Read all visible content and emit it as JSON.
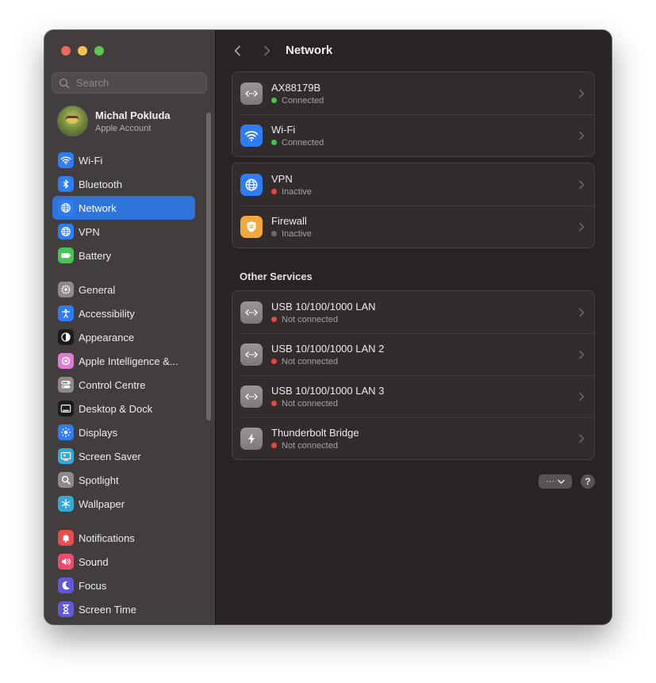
{
  "window": {
    "title": "Network"
  },
  "search": {
    "placeholder": "Search"
  },
  "account": {
    "name": "Michal Pokluda",
    "subtitle": "Apple Account"
  },
  "sidebar": {
    "groups": [
      [
        {
          "label": "Wi-Fi",
          "icon": "wifi-icon",
          "color": "#2f7df6"
        },
        {
          "label": "Bluetooth",
          "icon": "bluetooth-icon",
          "color": "#2f7df6"
        },
        {
          "label": "Network",
          "icon": "globe-icon",
          "color": "#2f7df6",
          "active": true
        },
        {
          "label": "VPN",
          "icon": "globe-icon",
          "color": "#2f7df6"
        },
        {
          "label": "Battery",
          "icon": "battery-icon",
          "color": "#45c553"
        }
      ],
      [
        {
          "label": "General",
          "icon": "gear-icon",
          "color": "#8e8a8a"
        },
        {
          "label": "Accessibility",
          "icon": "accessibility-icon",
          "color": "#2f7df6"
        },
        {
          "label": "Appearance",
          "icon": "appearance-icon",
          "color": "#1c1c1c"
        },
        {
          "label": "Apple Intelligence &...",
          "icon": "apple-intelligence-icon",
          "color": "#e07bd0"
        },
        {
          "label": "Control Centre",
          "icon": "control-centre-icon",
          "color": "#8e8a8a"
        },
        {
          "label": "Desktop & Dock",
          "icon": "dock-icon",
          "color": "#1c1c1c"
        },
        {
          "label": "Displays",
          "icon": "displays-icon",
          "color": "#2f7df6"
        },
        {
          "label": "Screen Saver",
          "icon": "screen-saver-icon",
          "color": "#35a9d6"
        },
        {
          "label": "Spotlight",
          "icon": "spotlight-icon",
          "color": "#8e8a8a"
        },
        {
          "label": "Wallpaper",
          "icon": "wallpaper-icon",
          "color": "#35a9d6"
        }
      ],
      [
        {
          "label": "Notifications",
          "icon": "notifications-icon",
          "color": "#ea4b4b"
        },
        {
          "label": "Sound",
          "icon": "sound-icon",
          "color": "#ea4b6a"
        },
        {
          "label": "Focus",
          "icon": "focus-icon",
          "color": "#6457d8"
        },
        {
          "label": "Screen Time",
          "icon": "screen-time-icon",
          "color": "#6457d8"
        }
      ]
    ]
  },
  "main": {
    "group1": [
      {
        "name": "AX88179B",
        "status": "Connected",
        "status_color": "#3fc84c",
        "icon": "ethernet-icon",
        "icon_color": "#8d8989"
      },
      {
        "name": "Wi-Fi",
        "status": "Connected",
        "status_color": "#3fc84c",
        "icon": "wifi-icon",
        "icon_color": "#2f7df6"
      }
    ],
    "group2": [
      {
        "name": "VPN",
        "status": "Inactive",
        "status_color": "#e8463e",
        "icon": "globe-icon",
        "icon_color": "#2f7df6"
      },
      {
        "name": "Firewall",
        "status": "Inactive",
        "status_color": "#6f6a6a",
        "icon": "firewall-icon",
        "icon_color": "#f2a83a"
      }
    ],
    "other_services_title": "Other Services",
    "other_services": [
      {
        "name": "USB 10/100/1000 LAN",
        "status": "Not connected",
        "status_color": "#e8463e",
        "icon": "ethernet-icon",
        "icon_color": "#8d8989"
      },
      {
        "name": "USB 10/100/1000 LAN 2",
        "status": "Not connected",
        "status_color": "#e8463e",
        "icon": "ethernet-icon",
        "icon_color": "#8d8989"
      },
      {
        "name": "USB 10/100/1000 LAN 3",
        "status": "Not connected",
        "status_color": "#e8463e",
        "icon": "ethernet-icon",
        "icon_color": "#8d8989"
      },
      {
        "name": "Thunderbolt Bridge",
        "status": "Not connected",
        "status_color": "#e8463e",
        "icon": "thunderbolt-icon",
        "icon_color": "#8d8989"
      }
    ],
    "more_button_label": "···",
    "help_button_label": "?"
  }
}
